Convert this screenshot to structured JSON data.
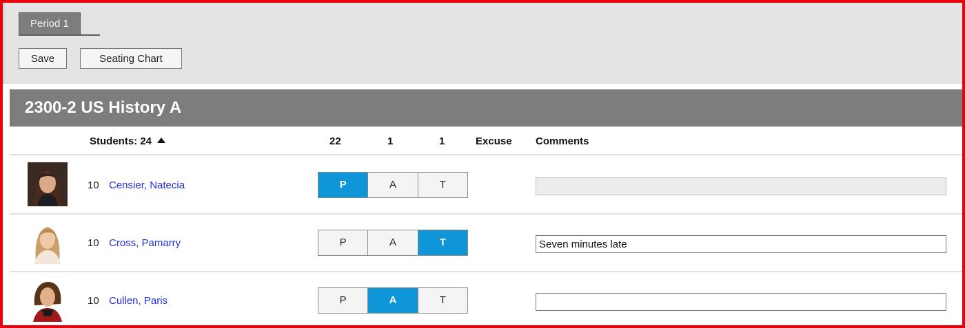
{
  "tab": {
    "label": "Period 1"
  },
  "toolbar": {
    "save_label": "Save",
    "seating_label": "Seating Chart"
  },
  "section": {
    "title": "2300-2 US History A"
  },
  "columns": {
    "students_label": "Students: 24",
    "present_count": "22",
    "absent_count": "1",
    "tardy_count": "1",
    "excuse_label": "Excuse",
    "comments_label": "Comments"
  },
  "status_labels": {
    "p": "P",
    "a": "A",
    "t": "T"
  },
  "colors": {
    "selected": "#0e96d8",
    "link": "#2230d8",
    "border_frame": "#e8000a"
  },
  "students": [
    {
      "grade": "10",
      "name": "Censier, Natecia",
      "status": "P",
      "comment": ""
    },
    {
      "grade": "10",
      "name": "Cross, Pamarry",
      "status": "T",
      "comment": "Seven minutes late"
    },
    {
      "grade": "10",
      "name": "Cullen, Paris",
      "status": "A",
      "comment": ""
    }
  ]
}
